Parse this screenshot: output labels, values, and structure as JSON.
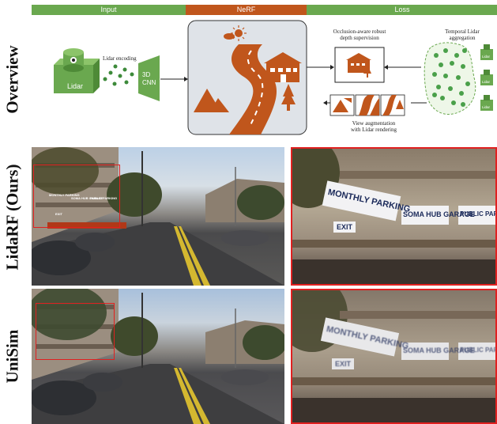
{
  "header": {
    "input_label": "Input",
    "nerf_label": "NeRF",
    "loss_label": "Loss",
    "colors": {
      "input": "#6aa84f",
      "nerf": "#c0561c",
      "loss": "#6aa84f"
    }
  },
  "rows": {
    "overview": "Overview",
    "lidarf": "LidaRF (Ours)",
    "unisim": "UniSim"
  },
  "diagram": {
    "lidar_encoding": "Lidar encoding",
    "lidar_box": "Lidar",
    "cnn_label_line1": "3D",
    "cnn_label_line2": "CNN",
    "occlusion_line1": "Occlusion-aware robust",
    "occlusion_line2": "depth supervision",
    "temporal_line1": "Temporal Lidar",
    "temporal_line2": "aggregation",
    "view_aug_line1": "View augmentation",
    "view_aug_line2": "with Lidar rendering",
    "lidar_small": "Lidar",
    "colors": {
      "green": "#6aa84f",
      "orange": "#c0561c",
      "nerf_bg": "#dfe3e8"
    }
  },
  "images": {
    "sign_parking": "MONTHLY PARKING",
    "sign_soma": "SOMA HUB GARAGE",
    "sign_public": "PUBLIC PARKING",
    "sign_exit": "EXIT",
    "sign_parking_blur": "MONTHLY PARKING",
    "sign_soma_blur": "SOMA HUB GARAGE",
    "sign_public_blur": "PUBLIC PARKING",
    "sign_exit_blur": "EXIT",
    "colors": {
      "crop_border": "#e02020"
    }
  }
}
